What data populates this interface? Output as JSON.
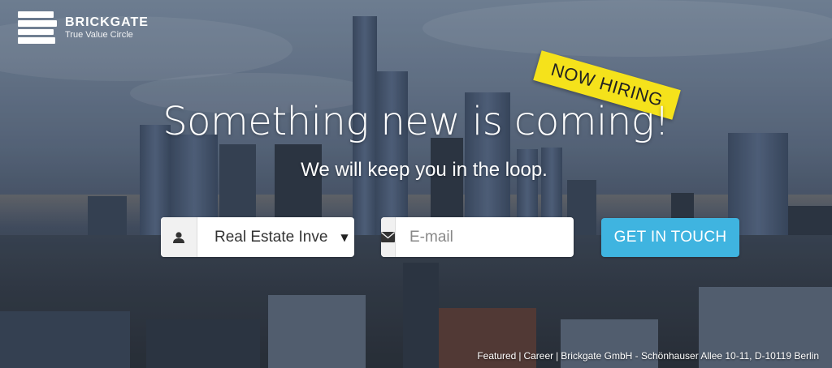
{
  "brand": {
    "name": "BRICKGATE",
    "tagline": "True Value Circle"
  },
  "ribbon": {
    "label": "NOW HIRING",
    "color": "#f5e21b"
  },
  "hero": {
    "headline": "Something new is coming!",
    "subhead": "We will keep you in the loop."
  },
  "form": {
    "role_select": {
      "value": "Real Estate Inve",
      "icon": "user-icon"
    },
    "email": {
      "placeholder": "E-mail",
      "value": "",
      "icon": "envelope-icon"
    },
    "submit_label": "GET IN TOUCH",
    "submit_color": "#3fb4e0"
  },
  "footer": {
    "featured": "Featured",
    "career": "Career",
    "address": "Brickgate GmbH - Schönhauser Allee 10-11, D-10119 Berlin"
  }
}
